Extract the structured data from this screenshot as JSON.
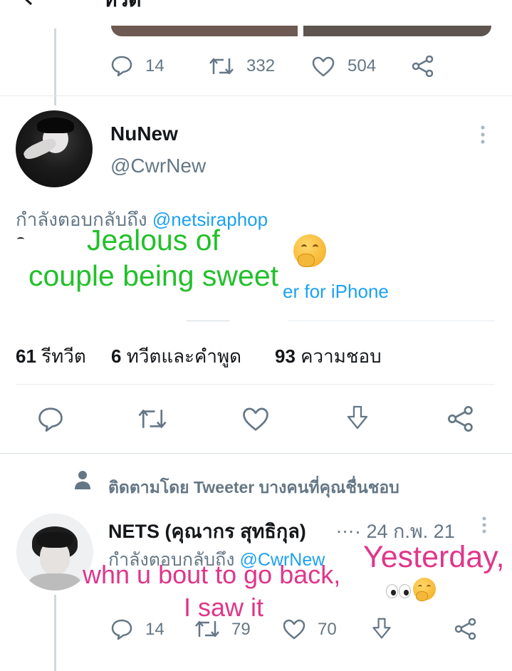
{
  "header": {
    "title_partial": "ทวีต"
  },
  "prev_tweet": {
    "reply_count": "14",
    "retweet_count": "332",
    "like_count": "504"
  },
  "main_tweet": {
    "name": "NuNew",
    "handle": "@CwrNew",
    "replying_to_label": "กำลังตอบกลับถึง",
    "replying_to_handle": "@netsiraphop",
    "source_partial": "er for iPhone",
    "stats": [
      {
        "count": "61",
        "label": "รีทวีต"
      },
      {
        "count": "6",
        "label": "ทวีตและคำพูด"
      },
      {
        "count": "93",
        "label": "ความชอบ"
      }
    ]
  },
  "overlay": {
    "green_line1": "Jealous of",
    "green_line2": "couple being sweet",
    "pink_yesterday": "Yesterday,",
    "pink_line1": "whn u bout to go back,",
    "pink_line2": "I saw it"
  },
  "reply_tweet": {
    "social_context": "ติดตามโดย Tweeter บางคนที่คุณชื่นชอบ",
    "name": "NETS (คุณากร สุทธิกุล)",
    "ellipsis": "…",
    "date": "· 24 ก.พ. 21",
    "replying_to_label": "กำลังตอบกลับถึง",
    "replying_to_handle": "@CwrNew",
    "reply_count": "14",
    "retweet_count": "79",
    "like_count": "70"
  },
  "colors": {
    "link": "#1da1f2",
    "muted": "#657786",
    "overlay_green": "#22c02a",
    "overlay_pink": "#e0368a"
  }
}
